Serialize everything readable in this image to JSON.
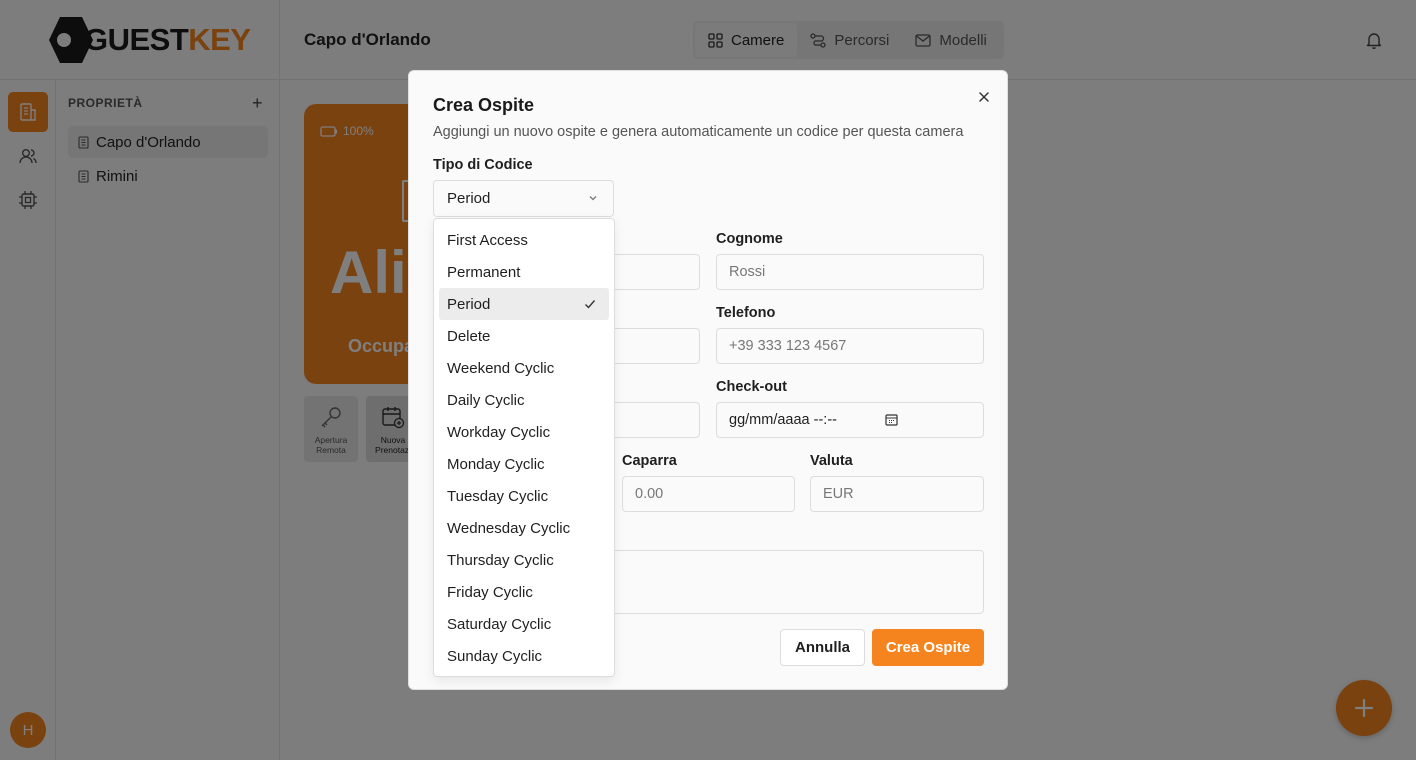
{
  "app": {
    "logo_prefix": "GUEST",
    "logo_suffix": "KEY",
    "page_title": "Capo d'Orlando"
  },
  "nav": {
    "tabs": [
      {
        "label": "Camere",
        "icon": "grid-icon",
        "active": true
      },
      {
        "label": "Percorsi",
        "icon": "route-icon",
        "active": false
      },
      {
        "label": "Modelli",
        "icon": "mail-icon",
        "active": false
      }
    ]
  },
  "sidebar": {
    "heading": "PROPRIETÀ",
    "add_symbol": "+",
    "items": [
      {
        "label": "Capo d'Orlando",
        "active": true
      },
      {
        "label": "Rimini",
        "active": false
      }
    ],
    "avatar_initial": "H"
  },
  "background": {
    "battery": "100%",
    "guest_name": "Alic",
    "status": "Occupa",
    "actions": [
      {
        "label": "Apertura Remota"
      },
      {
        "label": "Nuova Prenotazi"
      }
    ]
  },
  "dialog": {
    "title": "Crea Ospite",
    "description": "Aggiungi un nuovo ospite e genera automaticamente un codice per questa camera",
    "code_type_label": "Tipo di Codice",
    "code_type_value": "Period",
    "surname_label": "Cognome",
    "surname_placeholder": "Rossi",
    "phone_label": "Telefono",
    "phone_placeholder": "+39 333 123 4567",
    "checkout_label": "Check-out",
    "checkout_placeholder": "gg/mm/aaaa --:--",
    "deposit_label": "Caparra",
    "deposit_placeholder": "0.00",
    "currency_label": "Valuta",
    "currency_placeholder": "EUR",
    "cancel_label": "Annulla",
    "submit_label": "Crea Ospite",
    "close_symbol": "×"
  },
  "dropdown": {
    "options": [
      "First Access",
      "Permanent",
      "Period",
      "Delete",
      "Weekend Cyclic",
      "Daily Cyclic",
      "Workday Cyclic",
      "Monday Cyclic",
      "Tuesday Cyclic",
      "Wednesday Cyclic",
      "Thursday Cyclic",
      "Friday Cyclic",
      "Saturday Cyclic",
      "Sunday Cyclic"
    ],
    "selected": "Period"
  },
  "colors": {
    "accent": "#f5841f",
    "overlay": "rgba(0,0,0,0.5)"
  }
}
